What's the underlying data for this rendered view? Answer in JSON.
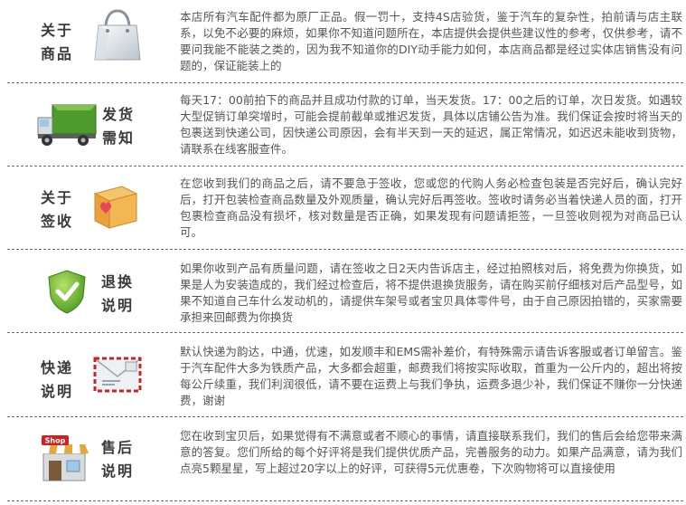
{
  "sections": [
    {
      "title_line1": "关于",
      "title_line2": "商品",
      "icon": "shopping-bag-icon",
      "body": "本店所有汽车配件都为原厂正品。假一罚十，支持4S店验货，鉴于汽车的复杂性，拍前请与店主联系，以免不必要的麻烦，如果你不知道问题所在，本店提供会提供些建议性的参考，仅供参考，请不要问我能不能装之类的，因为我不知道你的DIY动手能力如何，本店商品都是经过实体店销售没有问题的，保证能装上的"
    },
    {
      "title_line1": "发货",
      "title_line2": "需知",
      "icon": "delivery-truck-icon",
      "body": "每天17：00前拍下的商品并且成功付款的订单，当天发货。17：00之后的订单，次日发货。如遇较大型促销订单突增时，可能会提前截单或推迟发货，具体以店铺公告为准。我们保证会按时将当天的包裹送到快递公司，因快递公司原因，会有半天到一天的延迟，属正常情况，如迟迟未能收到货物，请联系在线客服查件。"
    },
    {
      "title_line1": "关于",
      "title_line2": "签收",
      "icon": "package-box-icon",
      "body": "在您收到我们的商品之后，请不要急于签收，您或您的代购人务必检查包装是否完好后，确认完好后，打开包装检查商品数量及外观质量，确认完好后再签收。签收时请务必当着快递人员的面，打开包裹检查商品没有损坏，核对数量是否正确，如果发现有问题请拒签，一旦签收则视为对商品已认可。"
    },
    {
      "title_line1": "退换",
      "title_line2": "说明",
      "icon": "check-shield-icon",
      "body": "如果你收到产品有质量问题，请在签收之日2天内告诉店主，经过拍照核对后，将免费为你换货，如果是人为安装造成的，我们经过检查后，将不提供退换货服务，请在购买前仔细核对后产品型号，如果不知道自己车什么发动机的，请提供车架号或者宝贝具体零件号，由于自己原因拍错的，买家需要承担来回邮费为你换货"
    },
    {
      "title_line1": "快递",
      "title_line2": "说明",
      "icon": "envelope-icon",
      "body": "默认快递为韵达，中通，优速，如发顺丰和EMS需补差价，有特殊需示请告诉客服或者订单留言。鉴于汽车配件大多为铁质产品，大多都会超重，邮费我们将按实际收取，首重为一公斤内的，超出将按每公斤续重，我们利润很低，请不要在运费上与我们争执，运费多退少补，我们保证不赚你一分快递费，谢谢"
    },
    {
      "title_line1": "售后",
      "title_line2": "说明",
      "icon": "shop-storefront-icon",
      "icon_text": "Shop",
      "body": "您在收到宝贝后，如果觉得有不满意或者不顺心的事情，请直接联系我们，我们的售后会给您带来满意的答复。您们所给的每个好评将是我们提供优质产品，完善服务的动力。如果产品满意，请为我们点亮5颗星星，写上超过20字以上的好评，可获得5元优惠卷，下次购物将可以直接使用"
    }
  ]
}
